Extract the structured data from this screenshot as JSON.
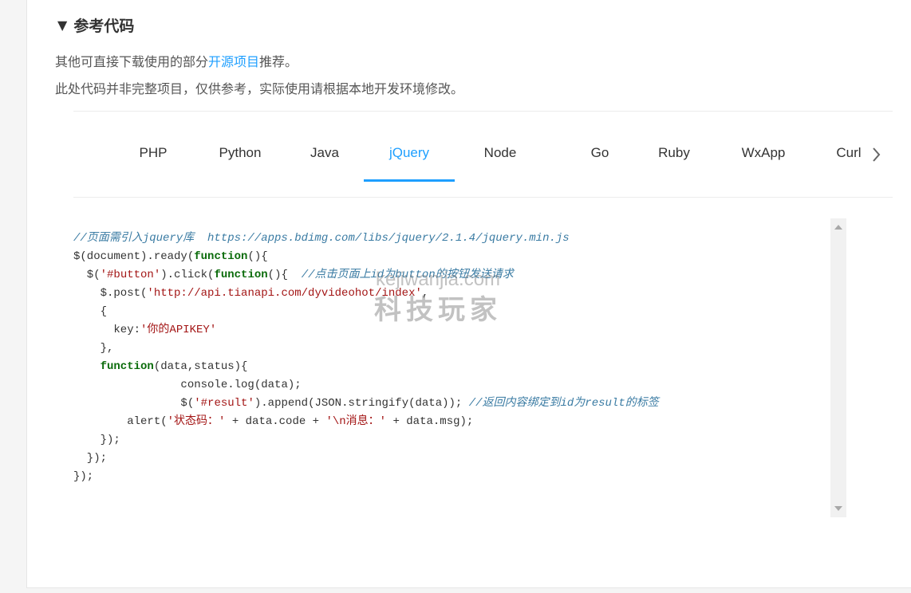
{
  "section": {
    "title": "参考代码",
    "caret": "▼"
  },
  "description": {
    "line1_prefix": "其他可直接下载使用的部分",
    "line1_link": "开源项目",
    "line1_suffix": "推荐。",
    "line2": "此处代码并非完整项目，仅供参考，实际使用请根据本地开发环境修改。"
  },
  "tabs": {
    "items": [
      "PHP",
      "Python",
      "Java",
      "jQuery",
      "Node",
      "Go",
      "Ruby",
      "WxApp",
      "Curl"
    ],
    "active": "jQuery"
  },
  "code": {
    "l1_comment": "//页面需引入jquery库  https://apps.bdimg.com/libs/jquery/2.1.4/jquery.min.js",
    "l2a": "$(document).ready(",
    "l2_kw": "function",
    "l2b": "(){",
    "l3a": "  $(",
    "l3_str": "'#button'",
    "l3b": ").click(",
    "l3_kw": "function",
    "l3c": "(){  ",
    "l3_comment": "//点击页面上id为button的按钮发送请求",
    "l4a": "    $.post(",
    "l4_str": "'http://api.tianapi.com/dyvideohot/index'",
    "l4b": ",",
    "l5": "    {",
    "l6a": "      key:",
    "l6_str": "'你的APIKEY'",
    "l7": "    },",
    "l8_kw": "    function",
    "l8b": "(data,status){",
    "l9": "                console.log(data);",
    "l10a": "                $(",
    "l10_str": "'#result'",
    "l10b": ").append(JSON.stringify(data)); ",
    "l10_comment": "//返回内容绑定到id为result的标签",
    "l11a": "        alert(",
    "l11_str1": "'状态码：'",
    "l11b": " + data.code + ",
    "l11_str2": "'\\n消息：'",
    "l11c": " + data.msg);",
    "l12": "    });",
    "l13": "  });",
    "l14": "});"
  },
  "watermark": {
    "line1": "kejiwanjia.com",
    "line2": "科技玩家"
  },
  "colors": {
    "accent": "#1e9fff",
    "comment": "#3a7ba3",
    "keyword": "#0a6b0a",
    "string": "#a31515"
  }
}
